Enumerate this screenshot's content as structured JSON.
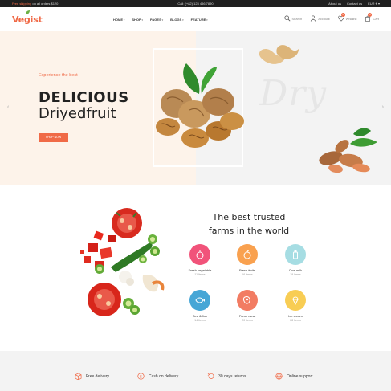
{
  "topbar": {
    "promo_highlight": "Free shipping",
    "promo_rest": " on all orders $120",
    "call": "Call: (+82) 123 456 7890",
    "about": "About us",
    "contact": "Contact us",
    "currency": "EUR € ▾"
  },
  "header": {
    "logo": "Vegist",
    "nav": [
      "HOME",
      "SHOP",
      "PAGES",
      "BLOGS",
      "FEATURE"
    ],
    "search": "Search",
    "account": "Account",
    "wishlist": "Wishlist",
    "wishlist_count": "0",
    "cart": "Cart",
    "cart_count": "0"
  },
  "hero": {
    "eyebrow": "Experience the best",
    "title1": "DELICIOUS",
    "title2": "Driyedfruit",
    "cta": "SHOP NOW",
    "script_word": "Dry",
    "prev": "‹",
    "next": "›"
  },
  "categories": {
    "title_line1": "The best trusted",
    "title_line2": "farms in the world",
    "items": [
      {
        "name": "Fresh vegetable",
        "count": "11 Items",
        "color": "#f1537a",
        "icon": "pepper-icon"
      },
      {
        "name": "Fresh fruits",
        "count": "16 Items",
        "color": "#f9a14f",
        "icon": "apple-icon"
      },
      {
        "name": "Cow milk",
        "count": "19 Items",
        "color": "#a6dde3",
        "icon": "milk-icon"
      },
      {
        "name": "Sea & fish",
        "count": "14 Items",
        "color": "#46a6d6",
        "icon": "fish-icon"
      },
      {
        "name": "Fresh meat",
        "count": "20 Items",
        "color": "#f27c63",
        "icon": "meat-icon"
      },
      {
        "name": "Ice cream",
        "count": "28 Items",
        "color": "#f8cd54",
        "icon": "ice-cream-icon"
      }
    ]
  },
  "features": [
    {
      "label": "Free delivery",
      "icon": "box-icon"
    },
    {
      "label": "Cash on delivery",
      "icon": "dollar-icon"
    },
    {
      "label": "30 days returns",
      "icon": "return-icon"
    },
    {
      "label": "Online support",
      "icon": "globe-icon"
    }
  ],
  "colors": {
    "accent": "#f06a47",
    "hero_left": "#fdf3ea",
    "hero_right": "#f3f3f3",
    "footer": "#f3f3f3"
  }
}
